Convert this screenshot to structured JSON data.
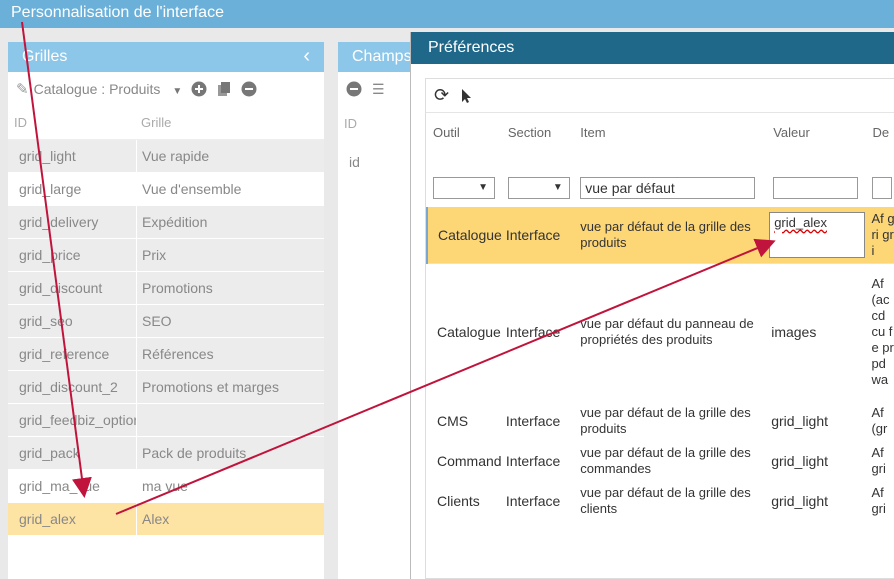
{
  "window": {
    "title": "Personnalisation de l'interface"
  },
  "grilles": {
    "title": "Grilles",
    "selector": "Catalogue : Produits",
    "headers": {
      "id": "ID",
      "grille": "Grille"
    },
    "rows": [
      {
        "id": "grid_light",
        "grille": "Vue rapide"
      },
      {
        "id": "grid_large",
        "grille": "Vue d'ensemble"
      },
      {
        "id": "grid_delivery",
        "grille": "Expédition"
      },
      {
        "id": "grid_price",
        "grille": "Prix"
      },
      {
        "id": "grid_discount",
        "grille": "Promotions"
      },
      {
        "id": "grid_seo",
        "grille": "SEO"
      },
      {
        "id": "grid_reference",
        "grille": "Références"
      },
      {
        "id": "grid_discount_2",
        "grille": "Promotions et marges"
      },
      {
        "id": "grid_feedbiz_option",
        "grille": ""
      },
      {
        "id": "grid_pack",
        "grille": "Pack de produits"
      },
      {
        "id": "grid_ma_vue",
        "grille": "ma vue"
      },
      {
        "id": "grid_alex",
        "grille": "Alex"
      }
    ]
  },
  "champs": {
    "title": "Champs",
    "header_id": "ID",
    "row1": "id"
  },
  "preferences": {
    "title": "Préférences",
    "headers": {
      "outil": "Outil",
      "section": "Section",
      "item": "Item",
      "valeur": "Valeur",
      "desc": "De"
    },
    "filter_item": "vue par défaut",
    "rows": [
      {
        "outil": "Catalogue",
        "section": "Interface",
        "item": "vue par défaut de la grille des produits",
        "valeur": "grid_alex",
        "desc": "Af gri gri"
      },
      {
        "outil": "Catalogue",
        "section": "Interface",
        "item": "vue par défaut du panneau de propriétés des produits",
        "valeur": "images",
        "desc": "Af (ac cd cu fe pr pd wa"
      },
      {
        "outil": "CMS",
        "section": "Interface",
        "item": "vue par défaut de la grille des produits",
        "valeur": "grid_light",
        "desc": "Af (gr"
      },
      {
        "outil": "Command",
        "section": "Interface",
        "item": "vue par défaut de la grille des commandes",
        "valeur": "grid_light",
        "desc": "Af gri"
      },
      {
        "outil": "Clients",
        "section": "Interface",
        "item": "vue par défaut de la grille des clients",
        "valeur": "grid_light",
        "desc": "Af gri"
      }
    ]
  },
  "colors": {
    "accent": "#c0143c",
    "selection": "#fdd676",
    "header": "#20688a"
  }
}
